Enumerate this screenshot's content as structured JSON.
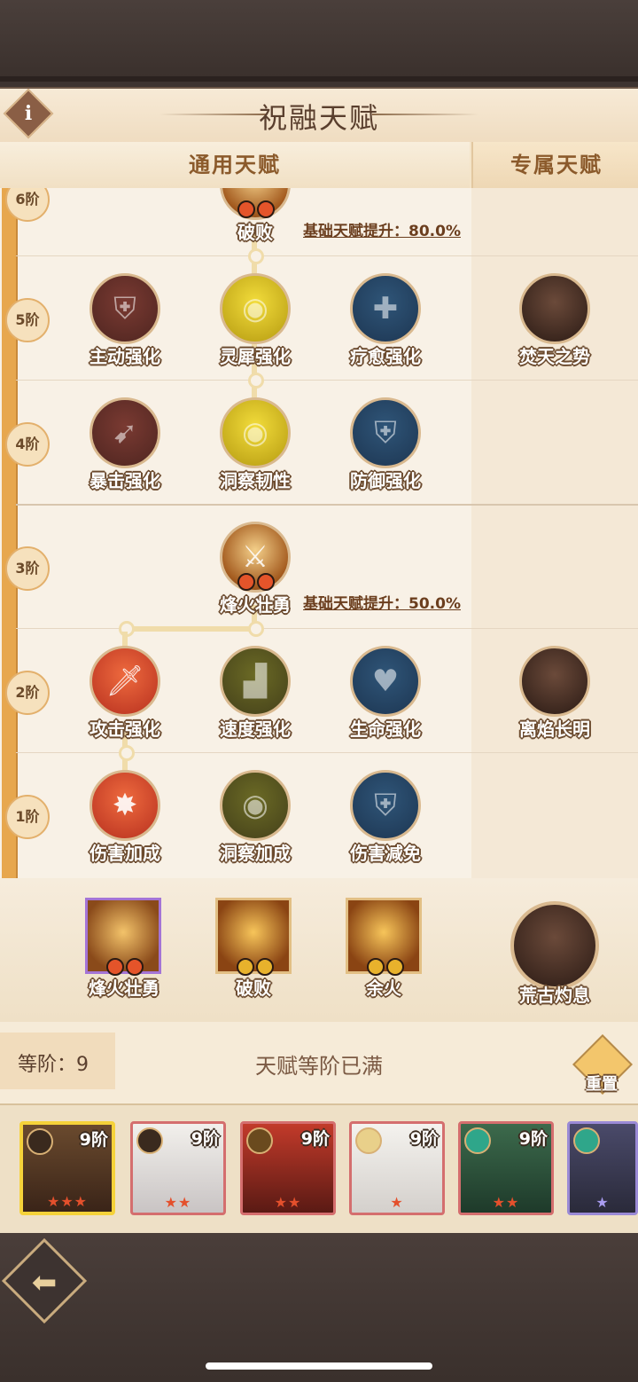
{
  "header": {
    "title": "祝融天赋",
    "info_label": "i"
  },
  "tabs": [
    {
      "label": "通用天赋"
    },
    {
      "label": "专属天赋"
    }
  ],
  "tiers": [
    "6阶",
    "5阶",
    "4阶",
    "3阶",
    "2阶",
    "1阶"
  ],
  "bonuses": [
    {
      "text": "基础天赋提升：80.0%"
    },
    {
      "text": "基础天赋提升：50.0%"
    }
  ],
  "nodes": {
    "t6": {
      "name": "破败"
    },
    "t5": [
      "主动强化",
      "灵犀强化",
      "疗愈强化"
    ],
    "t4": [
      "暴击强化",
      "洞察韧性",
      "防御强化"
    ],
    "t3": {
      "name": "烽火壮勇"
    },
    "t2": [
      "攻击强化",
      "速度强化",
      "生命强化"
    ],
    "t1": [
      "伤害加成",
      "洞察加成",
      "伤害减免"
    ]
  },
  "exclusive": [
    "焚天之势",
    "离焰长明"
  ],
  "equipped": [
    {
      "name": "烽火壮勇"
    },
    {
      "name": "破败"
    },
    {
      "name": "余火"
    }
  ],
  "equipped_exclusive": {
    "name": "荒古灼息"
  },
  "status": {
    "level_label": "等阶：",
    "level_value": "9",
    "max_text": "天赋等阶已满",
    "reset_label": "重置"
  },
  "heroes": [
    {
      "tier": "9阶",
      "stars": "★★★"
    },
    {
      "tier": "9阶",
      "stars": "★★"
    },
    {
      "tier": "9阶",
      "stars": "★★"
    },
    {
      "tier": "9阶",
      "stars": "★"
    },
    {
      "tier": "9阶",
      "stars": "★★"
    },
    {
      "tier": "",
      "stars": "★"
    }
  ],
  "colors": {
    "accent": "#e7a74e",
    "title": "#5a3f2e",
    "tab_text": "#8b5a2b"
  }
}
